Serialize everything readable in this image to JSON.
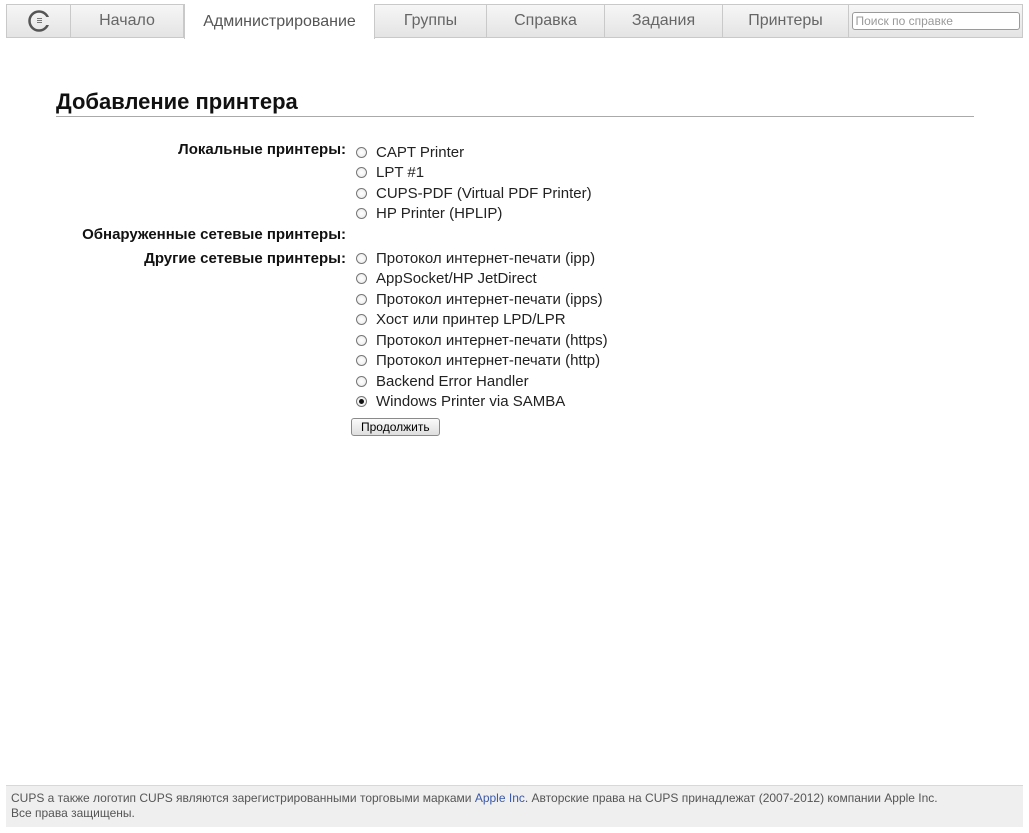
{
  "nav": {
    "logo_icon": "cups-logo-icon",
    "tabs": [
      {
        "label": "Начало"
      },
      {
        "label": "Администрирование",
        "active": true
      },
      {
        "label": "Группы"
      },
      {
        "label": "Справка"
      },
      {
        "label": "Задания"
      },
      {
        "label": "Принтеры"
      }
    ],
    "search_placeholder": "Поиск по справке"
  },
  "page": {
    "title": "Добавление принтера"
  },
  "form": {
    "local_label": "Локальные принтеры:",
    "local_printers": [
      "CAPT Printer",
      "LPT #1",
      "CUPS-PDF (Virtual PDF Printer)",
      "HP Printer (HPLIP)"
    ],
    "discovered_label": "Обнаруженные сетевые принтеры:",
    "other_label": "Другие сетевые принтеры:",
    "other_printers": [
      "Протокол интернет-печати (ipp)",
      "AppSocket/HP JetDirect",
      "Протокол интернет-печати (ipps)",
      "Хост или принтер LPD/LPR",
      "Протокол интернет-печати (https)",
      "Протокол интернет-печати (http)",
      "Backend Error Handler",
      "Windows Printer via SAMBA"
    ],
    "selected": "Windows Printer via SAMBA",
    "continue_label": "Продолжить"
  },
  "footer": {
    "text_before": "CUPS а также логотип CUPS являются зарегистрированными торговыми марками ",
    "link": "Apple Inc",
    "text_after": ". Авторские права на CUPS принадлежат (2007-2012) компании Apple Inc.",
    "line2": "Все права защищены."
  }
}
